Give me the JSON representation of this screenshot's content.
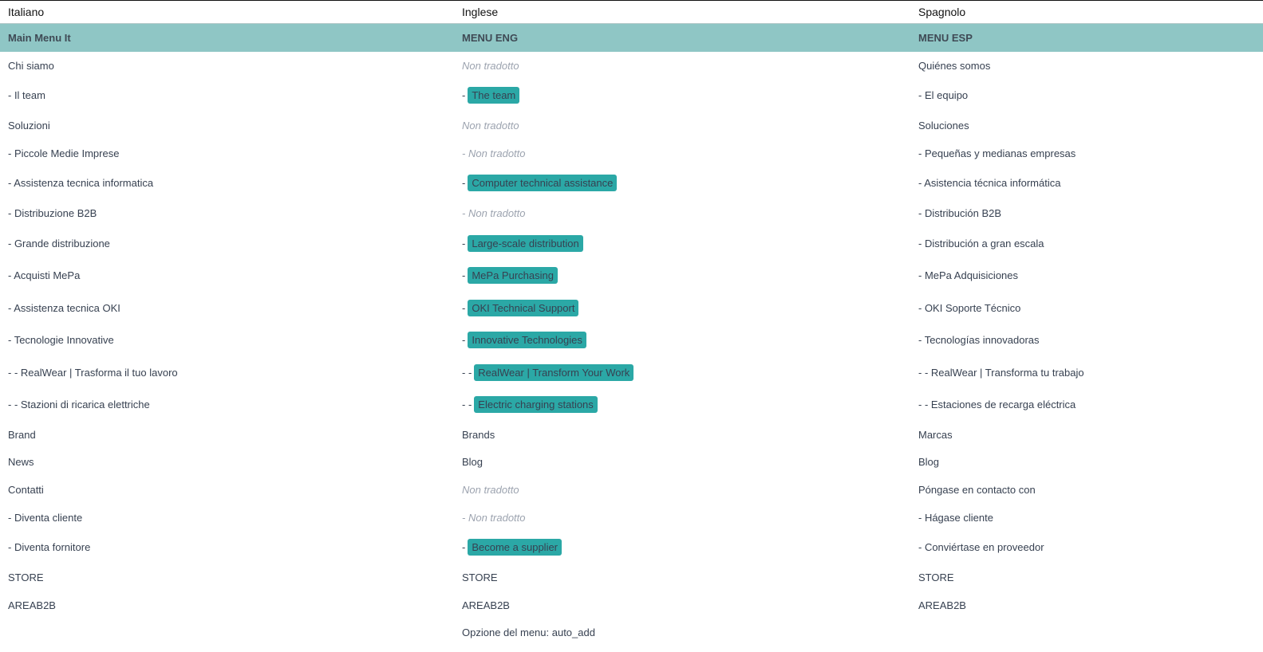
{
  "columns": {
    "it": "Italiano",
    "en": "Inglese",
    "es": "Spagnolo"
  },
  "menu_header": {
    "it": "Main Menu It",
    "en": "MENU ENG",
    "es": "MENU ESP"
  },
  "colors": {
    "header_bg": "#8fc6c5",
    "badge": "#2ba8a6"
  },
  "rows": [
    {
      "it": "Chi siamo",
      "en_prefix": "",
      "en": "Non tradotto",
      "en_type": "missing",
      "es": "Quiénes somos"
    },
    {
      "it": "- Il team",
      "en_prefix": "-",
      "en": "The team",
      "en_type": "badge",
      "es": "- El equipo"
    },
    {
      "it": "Soluzioni",
      "en_prefix": "",
      "en": "Non tradotto",
      "en_type": "missing",
      "es": "Soluciones"
    },
    {
      "it": "- Piccole Medie Imprese",
      "en_prefix": "-",
      "en": "Non tradotto",
      "en_type": "missing",
      "es": "- Pequeñas y medianas empresas"
    },
    {
      "it": "- Assistenza tecnica informatica",
      "en_prefix": "-",
      "en": "Computer technical assistance",
      "en_type": "badge",
      "es": "- Asistencia técnica informática"
    },
    {
      "it": "- Distribuzione B2B",
      "en_prefix": "-",
      "en": "Non tradotto",
      "en_type": "missing",
      "es": "- Distribución B2B"
    },
    {
      "it": "- Grande distribuzione",
      "en_prefix": "-",
      "en": "Large-scale distribution",
      "en_type": "badge",
      "es": "- Distribución a gran escala"
    },
    {
      "it": "- Acquisti MePa",
      "en_prefix": "-",
      "en": "MePa Purchasing",
      "en_type": "badge",
      "es": "- MePa Adquisiciones"
    },
    {
      "it": "- Assistenza tecnica OKI",
      "en_prefix": "-",
      "en": "OKI Technical Support",
      "en_type": "badge",
      "es": "- OKI Soporte Técnico"
    },
    {
      "it": "- Tecnologie Innovative",
      "en_prefix": "-",
      "en": "Innovative Technologies",
      "en_type": "badge",
      "es": "- Tecnologías innovadoras"
    },
    {
      "it": "- - RealWear | Trasforma il tuo lavoro",
      "en_prefix": "- -",
      "en": "RealWear | Transform Your Work",
      "en_type": "badge",
      "es": "- - RealWear | Transforma tu trabajo"
    },
    {
      "it": "- - Stazioni di ricarica elettriche",
      "en_prefix": "- -",
      "en": "Electric charging stations",
      "en_type": "badge",
      "es": "- - Estaciones de recarga eléctrica"
    },
    {
      "it": "Brand",
      "en_prefix": "",
      "en": "Brands",
      "en_type": "plain",
      "es": "Marcas"
    },
    {
      "it": "News",
      "en_prefix": "",
      "en": "Blog",
      "en_type": "plain",
      "es": "Blog"
    },
    {
      "it": "Contatti",
      "en_prefix": "",
      "en": "Non tradotto",
      "en_type": "missing",
      "es": "Póngase en contacto con"
    },
    {
      "it": "- Diventa cliente",
      "en_prefix": "-",
      "en": "Non tradotto",
      "en_type": "missing",
      "es": "- Hágase cliente"
    },
    {
      "it": "- Diventa fornitore",
      "en_prefix": "-",
      "en": "Become a supplier",
      "en_type": "badge",
      "es": "- Conviértase en proveedor"
    },
    {
      "it": "STORE",
      "en_prefix": "",
      "en": "STORE",
      "en_type": "plain",
      "es": "STORE"
    },
    {
      "it": "AREAB2B",
      "en_prefix": "",
      "en": "AREAB2B",
      "en_type": "plain",
      "es": "AREAB2B"
    },
    {
      "it": "",
      "en_prefix": "",
      "en": "Opzione del menu: auto_add",
      "en_type": "plain",
      "es": ""
    }
  ]
}
